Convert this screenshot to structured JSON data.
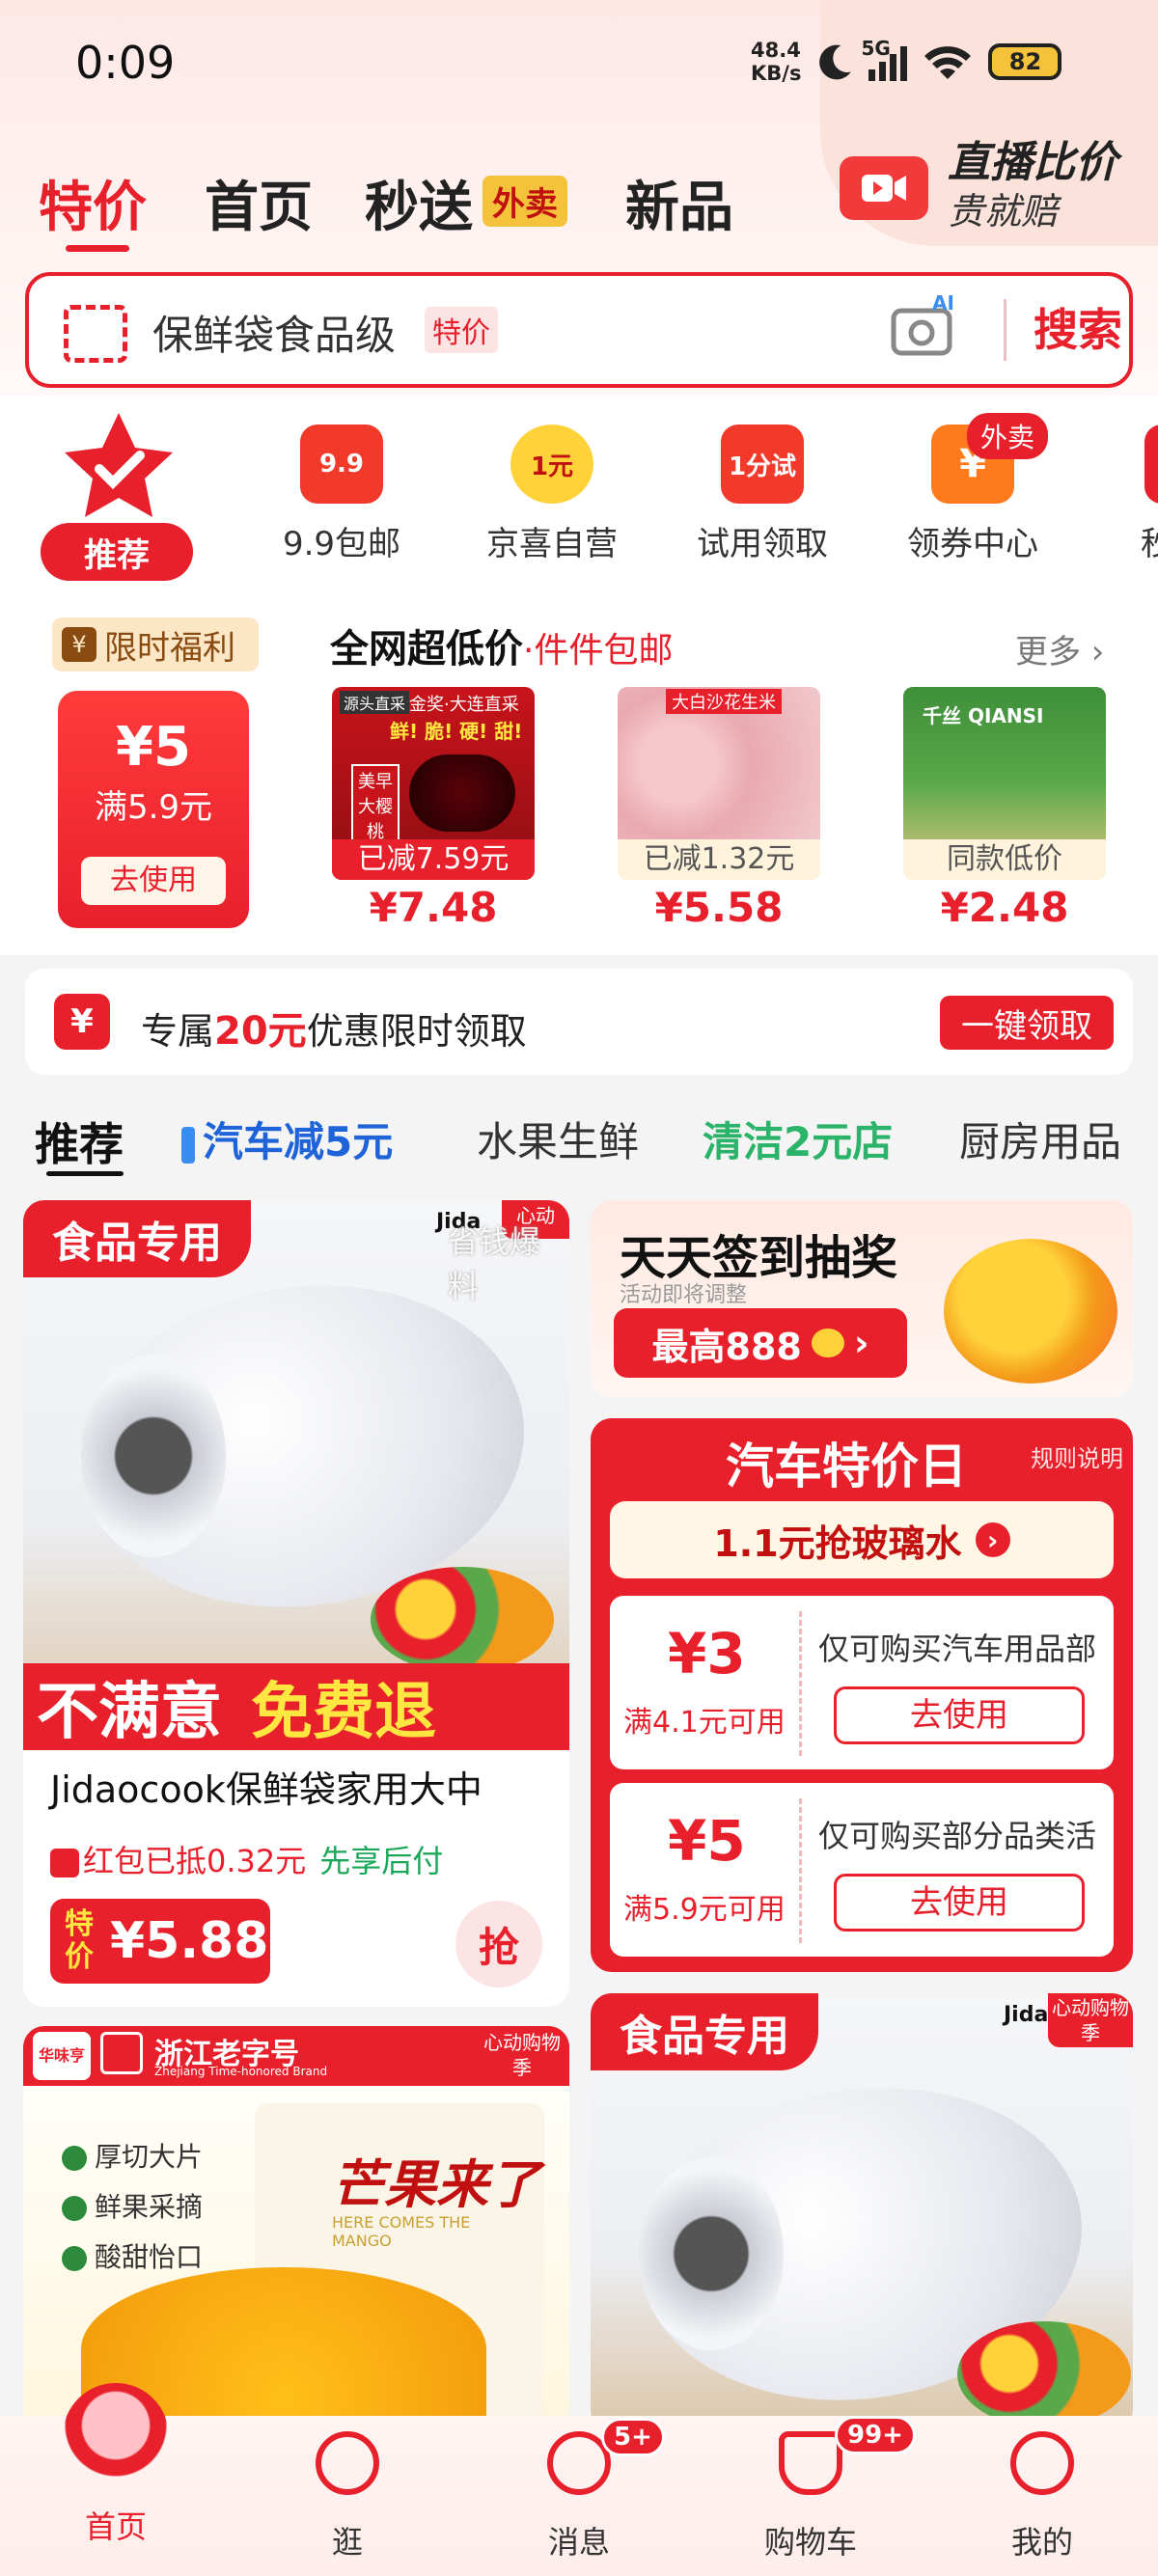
{
  "status_bar": {
    "time": "0:09",
    "net_speed_value": "48.4",
    "net_speed_unit": "KB/s",
    "network": "5G",
    "battery": "82"
  },
  "top_tabs": [
    {
      "label": "特价"
    },
    {
      "label": "首页"
    },
    {
      "label": "秒送"
    },
    {
      "label": "新品"
    }
  ],
  "waimai_badge": "外卖",
  "live": {
    "title": "直播比价",
    "subtitle": "贵就赔"
  },
  "search": {
    "query": "保鲜袋食品级",
    "tag": "特价",
    "button": "搜索",
    "ai_label": "AI"
  },
  "categories": [
    {
      "label": "推荐"
    },
    {
      "label": "9.9包邮",
      "icon_text": "9.9"
    },
    {
      "label": "京喜自营",
      "icon_text": "1元"
    },
    {
      "label": "试用领取",
      "icon_text": "1分试"
    },
    {
      "label": "领券中心",
      "icon_text": "¥",
      "badge": "外卖"
    },
    {
      "label": "秒"
    }
  ],
  "limited": {
    "tag": "限时福利",
    "coupon_amount": "¥5",
    "coupon_condition": "满5.9元",
    "coupon_button": "去使用"
  },
  "deals": {
    "title": "全网超低价",
    "subtitle": "·件件包邮",
    "more": "更多",
    "items": [
      {
        "tag": "已减7.59元",
        "price": "¥7.48",
        "img_text_1": "源头直采",
        "img_text_2": "金奖·大连直采",
        "img_text_3": "鲜! 脆! 硬! 甜!",
        "img_text_4": "美早大樱桃"
      },
      {
        "tag": "已减1.32元",
        "price": "¥5.58",
        "img_text_1": "大白沙花生米"
      },
      {
        "tag": "同款低价",
        "price": "¥2.48",
        "img_text_1": "千丝 QIANSI"
      }
    ]
  },
  "promo_banner": {
    "prefix": "专属",
    "amount": "20元",
    "suffix": "优惠限时领取",
    "button": "一键领取",
    "icon": "¥"
  },
  "content_tabs": [
    {
      "label": "推荐"
    },
    {
      "label": "汽车减5元"
    },
    {
      "label": "水果生鲜"
    },
    {
      "label": "清洁2元店"
    },
    {
      "label": "厨房用品"
    }
  ],
  "product1": {
    "badge": "食品专用",
    "brand": "Jida",
    "corner": "心动",
    "overlay": "省钱爆料",
    "strip_left": "不满意",
    "strip_right": "免费退",
    "name": "Jidaocook保鲜袋家用大中",
    "hongbao": "红包已抵0.32元",
    "pay_later": "先享后付",
    "price_label_1": "特",
    "price_label_2": "价",
    "price": "¥5.88",
    "grab": "抢"
  },
  "signin": {
    "title": "天天签到抽奖",
    "note": "活动即将调整",
    "button": "最高888"
  },
  "car_day": {
    "title": "汽车特价日",
    "rule": "规则说明",
    "glass": "1.1元抢玻璃水",
    "coupons": [
      {
        "amount": "¥3",
        "condition": "满4.1元可用",
        "desc": "仅可购买汽车用品部",
        "button": "去使用"
      },
      {
        "amount": "¥5",
        "condition": "满5.9元可用",
        "desc": "仅可购买部分品类活",
        "button": "去使用"
      }
    ]
  },
  "product3": {
    "brand_1": "华味亨",
    "brand_2": "浙江老字号",
    "brand_3": "Zhejiang Time-honored Brand",
    "corner": "心动购物季",
    "features": [
      "厚切大片",
      "鲜果采摘",
      "酸甜怡口"
    ],
    "pack_title": "芒果来了",
    "pack_sub": "HERE COMES THE MANGO"
  },
  "product4": {
    "badge": "食品专用",
    "brand": "Jida",
    "corner": "心动购物季"
  },
  "bottom_nav": [
    {
      "label": "首页"
    },
    {
      "label": "逛"
    },
    {
      "label": "消息",
      "badge": "5+"
    },
    {
      "label": "购物车",
      "badge": "99+"
    },
    {
      "label": "我的"
    }
  ]
}
